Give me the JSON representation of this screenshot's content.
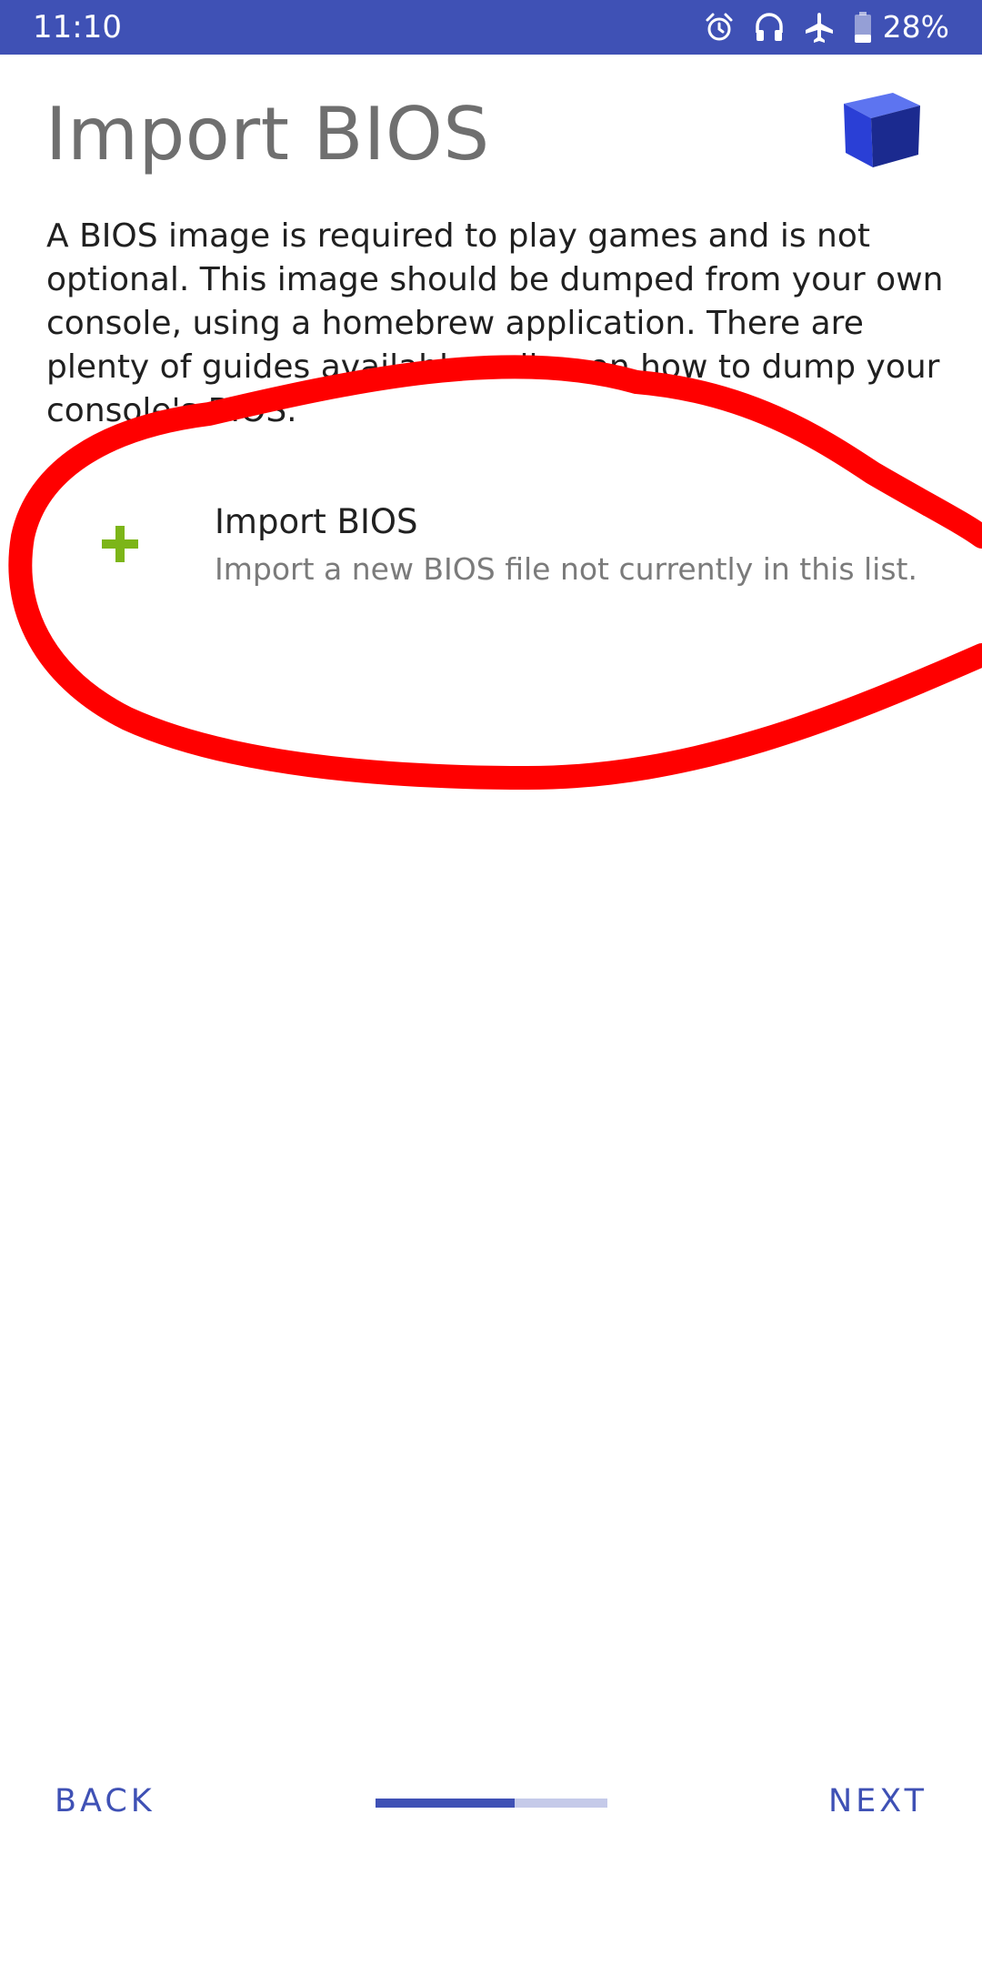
{
  "status_bar": {
    "time": "11:10",
    "battery": "28%",
    "icons": [
      "alarm-icon",
      "headset-icon",
      "airplane-icon",
      "battery-icon"
    ],
    "background": "#3f51b5"
  },
  "header": {
    "title": "Import BIOS",
    "logo_icon": "cube-logo-icon"
  },
  "description": "A BIOS image is required to play games and is not optional. This image should be dumped from your own console, using a homebrew application. There are plenty of guides available online on how to dump your console's BIOS.",
  "import_item": {
    "icon": "plus-icon",
    "title": "Import BIOS",
    "subtitle": "Import a new BIOS file not currently in this list."
  },
  "navigation": {
    "back_label": "BACK",
    "next_label": "NEXT",
    "progress": 0.6,
    "accent": "#3f51b5"
  }
}
